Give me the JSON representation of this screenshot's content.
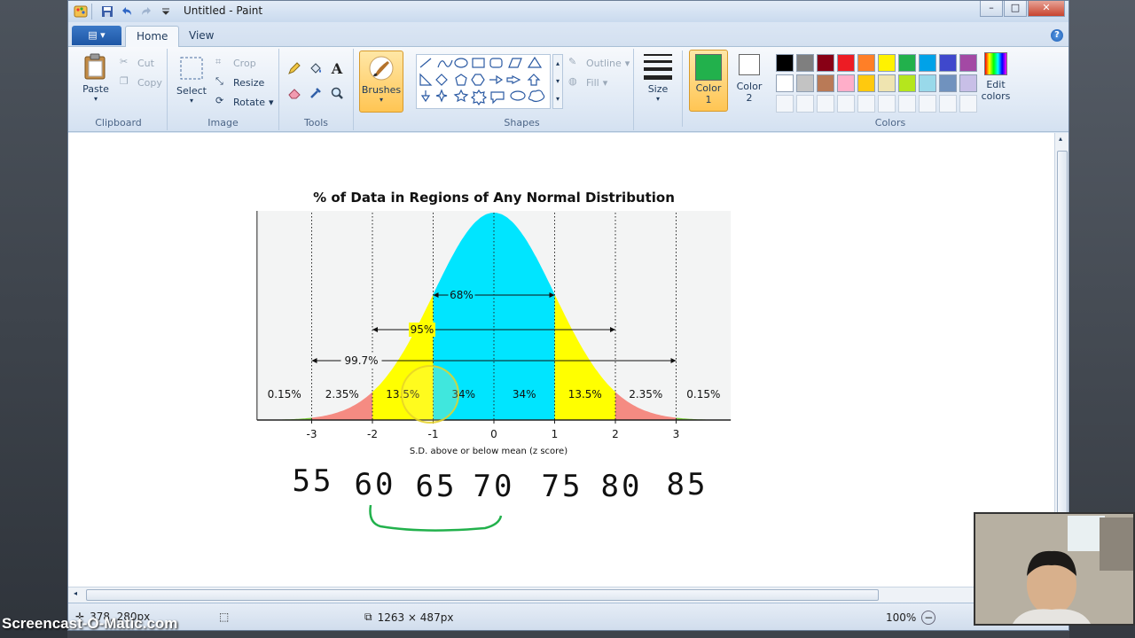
{
  "window": {
    "title": "Untitled - Paint",
    "controls": {
      "minimize": "–",
      "maximize": "□",
      "close": "✕"
    }
  },
  "tabs": [
    {
      "label": "Home",
      "active": true
    },
    {
      "label": "View",
      "active": false
    }
  ],
  "help_label": "?",
  "ribbon": {
    "clipboard": {
      "label": "Clipboard",
      "paste": "Paste",
      "cut": "Cut",
      "copy": "Copy"
    },
    "image": {
      "label": "Image",
      "select": "Select",
      "crop": "Crop",
      "resize": "Resize",
      "rotate": "Rotate"
    },
    "tools": {
      "label": "Tools"
    },
    "brushes": {
      "label": "Brushes"
    },
    "shapes": {
      "label": "Shapes",
      "outline": "Outline",
      "fill": "Fill"
    },
    "size": {
      "label": "Size"
    },
    "color1": {
      "label": "Color",
      "number": "1",
      "value": "#22b14c"
    },
    "color2": {
      "label": "Color",
      "number": "2",
      "value": "#ffffff"
    },
    "colors": {
      "label": "Colors",
      "edit": "Edit colors",
      "row1": [
        "#000000",
        "#7f7f7f",
        "#880015",
        "#ed1c24",
        "#ff7f27",
        "#fff200",
        "#22b14c",
        "#00a2e8",
        "#3f48cc",
        "#a349a4"
      ],
      "row2": [
        "#ffffff",
        "#c3c3c3",
        "#b97a57",
        "#ffaec9",
        "#ffc90e",
        "#efe4b0",
        "#b5e61d",
        "#99d9ea",
        "#7092be",
        "#c8bfe7"
      ]
    }
  },
  "canvas": {
    "handwritten_numbers": [
      "55",
      "60",
      "65",
      "70",
      "75",
      "80",
      "85"
    ]
  },
  "chart_data": {
    "type": "area",
    "title": "% of Data in Regions of Any Normal Distribution",
    "xlabel": "S.D. above or below mean (z score)",
    "ylabel": "",
    "xlim": [
      -3.9,
      3.9
    ],
    "x_ticks": [
      -3,
      -2,
      -1,
      0,
      1,
      2,
      3
    ],
    "regions": [
      {
        "from": -3.9,
        "to": -3,
        "percent": "0.15%",
        "color": "#7ccd3a"
      },
      {
        "from": -3,
        "to": -2,
        "percent": "2.35%",
        "color": "#f58b82"
      },
      {
        "from": -2,
        "to": -1,
        "percent": "13.5%",
        "color": "#ffff00"
      },
      {
        "from": -1,
        "to": 0,
        "percent": "34%",
        "color": "#00e5ff"
      },
      {
        "from": 0,
        "to": 1,
        "percent": "34%",
        "color": "#00e5ff"
      },
      {
        "from": 1,
        "to": 2,
        "percent": "13.5%",
        "color": "#ffff00"
      },
      {
        "from": 2,
        "to": 3,
        "percent": "2.35%",
        "color": "#f58b82"
      },
      {
        "from": 3,
        "to": 3.9,
        "percent": "0.15%",
        "color": "#7ccd3a"
      }
    ],
    "spans": [
      {
        "label": "68%",
        "from": -1,
        "to": 1
      },
      {
        "label": "95%",
        "from": -2,
        "to": 2
      },
      {
        "label": "99.7%",
        "from": -3,
        "to": 3
      }
    ]
  },
  "status": {
    "cursor_position": "378, 280px",
    "image_size": "1263 × 487px",
    "zoom": "100%"
  },
  "overlay": {
    "watermark": "Screencast-O-Matic.com"
  }
}
